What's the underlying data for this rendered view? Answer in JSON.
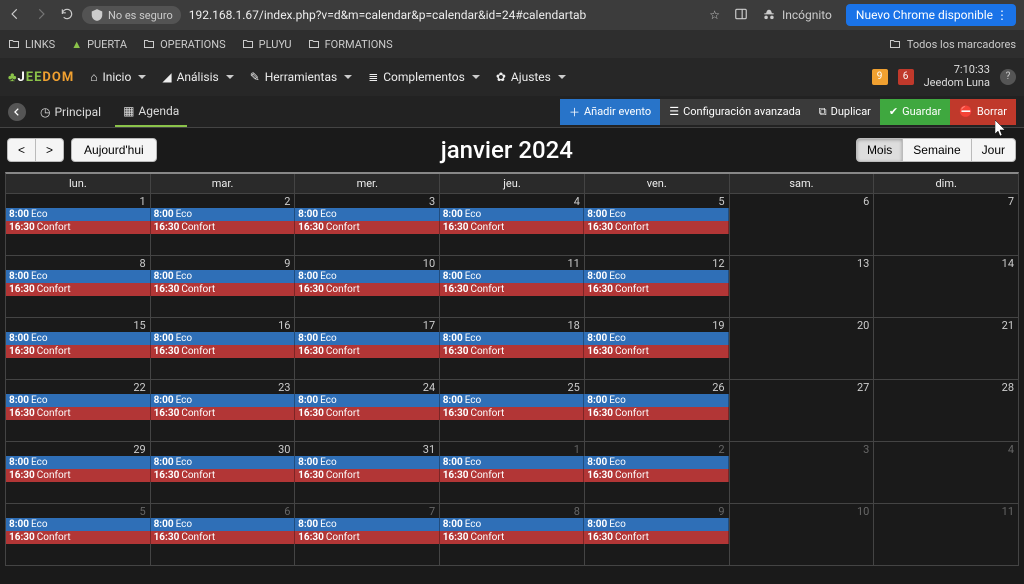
{
  "chrome": {
    "secure_label": "No es seguro",
    "url": "192.168.1.67/index.php?v=d&m=calendar&p=calendar&id=24#calendartab",
    "incognito_label": "Incógnito",
    "update_label": "Nuevo Chrome disponible"
  },
  "bookmarks": {
    "items": [
      "LINKS",
      "PUERTA",
      "OPERATIONS",
      "PLUYU",
      "FORMATIONS"
    ],
    "all_label": "Todos los marcadores"
  },
  "nav": {
    "items": [
      "Inicio",
      "Análisis",
      "Herramientas",
      "Complementos",
      "Ajustes"
    ],
    "badge1": "9",
    "badge2": "6",
    "time": "7:10:33",
    "host": "Jeedom Luna"
  },
  "toolbar": {
    "tab_principal": "Principal",
    "tab_agenda": "Agenda",
    "add_event": "Añadir evento",
    "advanced": "Configuración avanzada",
    "duplicate": "Duplicar",
    "save": "Guardar",
    "delete": "Borrar"
  },
  "calendar": {
    "today_btn": "Aujourd'hui",
    "title": "janvier 2024",
    "view_month": "Mois",
    "view_week": "Semaine",
    "view_day": "Jour",
    "dow": [
      "lun.",
      "mar.",
      "mer.",
      "jeu.",
      "ven.",
      "sam.",
      "dim."
    ],
    "event_eco": {
      "time": "8:00",
      "label": "Eco"
    },
    "event_confort": {
      "time": "16:30",
      "label": "Confort"
    },
    "weeks": [
      {
        "days": [
          1,
          2,
          3,
          4,
          5,
          6,
          7
        ],
        "other": []
      },
      {
        "days": [
          8,
          9,
          10,
          11,
          12,
          13,
          14
        ],
        "other": []
      },
      {
        "days": [
          15,
          16,
          17,
          18,
          19,
          20,
          21
        ],
        "other": []
      },
      {
        "days": [
          22,
          23,
          24,
          25,
          26,
          27,
          28
        ],
        "other": []
      },
      {
        "days": [
          29,
          30,
          31,
          1,
          2,
          3,
          4
        ],
        "other": [
          3,
          4,
          5,
          6
        ]
      },
      {
        "days": [
          5,
          6,
          7,
          8,
          9,
          10,
          11
        ],
        "other": [
          0,
          1,
          2,
          3,
          4,
          5,
          6
        ]
      }
    ]
  }
}
